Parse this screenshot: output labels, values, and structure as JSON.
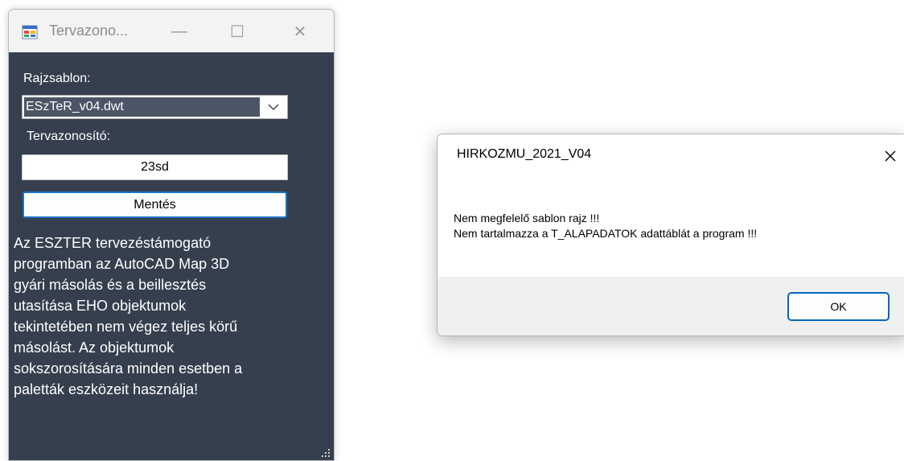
{
  "form_window": {
    "title": "Tervazono...",
    "controls": {
      "minimize": "—",
      "maximize": "☐",
      "close": "✕"
    },
    "template_label": "Rajzsablon:",
    "template_value": "ESzTeR_v04.dwt",
    "id_label": "Tervazonosító:",
    "id_value": "23sd",
    "save_button": "Mentés",
    "description": "Az ESZTER tervezéstámogató\nprogramban az AutoCAD Map 3D\ngyári másolás és a beillesztés\nutasítása EHO objektumok\ntekintetében nem végez teljes körű\nmásolást. Az objektumok\nsokszorosítására minden esetben a\npaletták eszközeit használja!"
  },
  "message_box": {
    "title": "HIRKOZMU_2021_V04",
    "line1": "Nem megfelelő sablon rajz !!!",
    "line2": "Nem tartalmazza a T_ALAPADATOK adattáblát a program !!!",
    "ok_button": "OK"
  },
  "colors": {
    "form_background": "#363f4e",
    "accent": "#1b74c9"
  }
}
